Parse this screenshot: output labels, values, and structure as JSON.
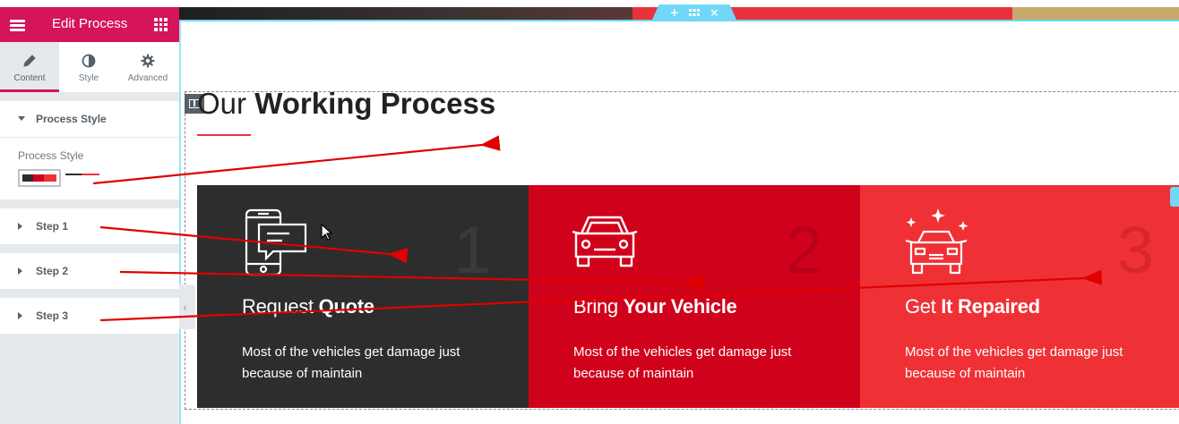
{
  "panel": {
    "title": "Edit Process",
    "tabs": [
      {
        "label": "Content"
      },
      {
        "label": "Style"
      },
      {
        "label": "Advanced"
      }
    ],
    "sections": [
      {
        "title": "Process Style",
        "expanded": true,
        "control_label": "Process Style"
      },
      {
        "title": "Step 1",
        "expanded": false
      },
      {
        "title": "Step 2",
        "expanded": false
      },
      {
        "title": "Step 3",
        "expanded": false
      }
    ]
  },
  "toolbar": {
    "add_icon": "+",
    "move_icon": "move-grid-icon",
    "close_icon": "×"
  },
  "page": {
    "heading_light": "Our ",
    "heading_bold": "Working Process",
    "steps": [
      {
        "number": "1",
        "title_light": "Request ",
        "title_bold": "Quote",
        "description": "Most of the vehicles get damage just because of maintain",
        "bg": "#2d2d2d",
        "num_color": "#3a3a3a",
        "icon": "phone-chat-icon"
      },
      {
        "number": "2",
        "title_light": "Bring ",
        "title_bold": "Your Vehicle",
        "description": "Most of the vehicles get damage just because of maintain",
        "bg": "#d0021b",
        "num_color": "#b8001a",
        "icon": "car-icon"
      },
      {
        "number": "3",
        "title_light": "Get ",
        "title_bold": "It Repaired",
        "description": "Most of the vehicles get damage just because of maintain",
        "bg": "#ef3136",
        "num_color": "#d9262b",
        "icon": "sparkling-car-icon"
      }
    ]
  },
  "colors": {
    "brand": "#d5145a",
    "accent_blue": "#71d7f7",
    "annotation_red": "#e00000"
  }
}
